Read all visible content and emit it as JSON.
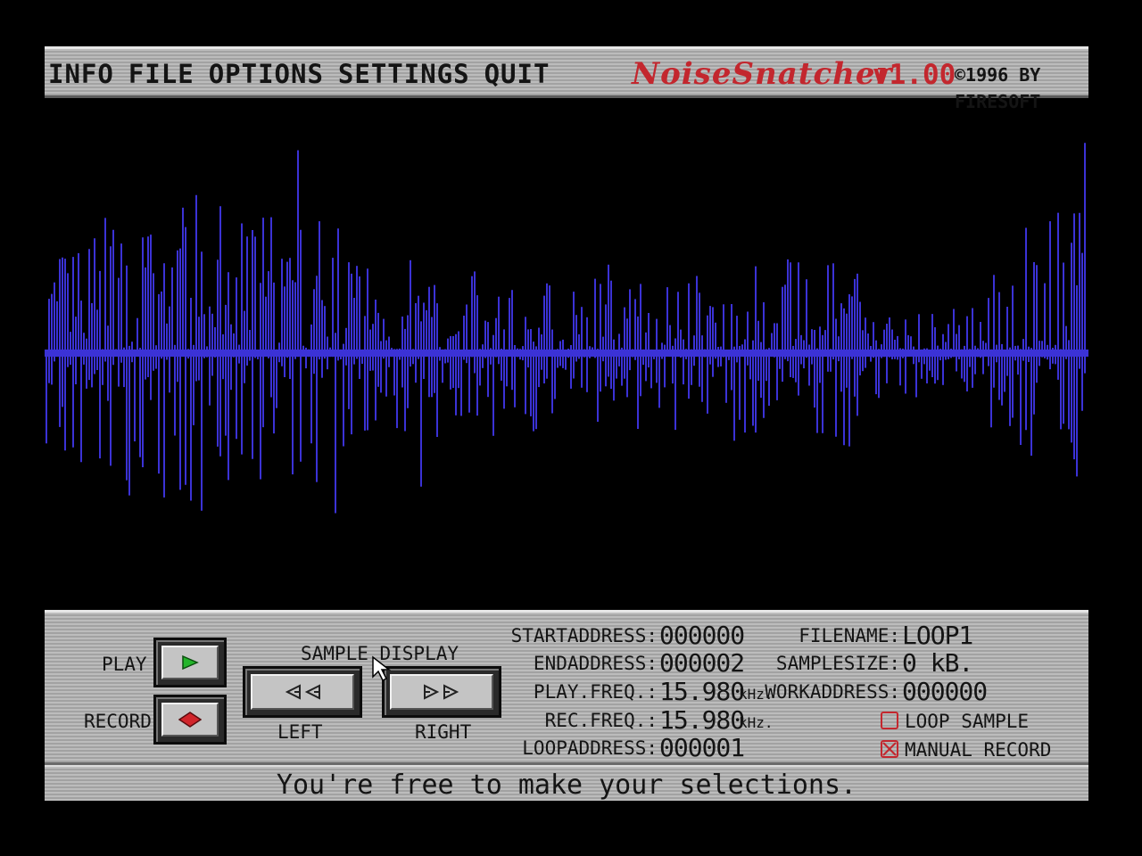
{
  "menu": {
    "items": [
      "INFO",
      "FILE",
      "OPTIONS",
      "SETTINGS",
      "QUIT"
    ],
    "app_title": "NoiseSnatcher",
    "app_version": "v1.00",
    "copyright": "©1996 BY FIRESOFT"
  },
  "colors": {
    "waveform": "#3b32d6",
    "title_red": "#c3272e",
    "play_green": "#23b52a",
    "record_red": "#d1252b"
  },
  "transport": {
    "play_label": "PLAY",
    "record_label": "RECORD",
    "play_icon": "play-triangle-icon",
    "record_icon": "record-diamond-icon"
  },
  "sample_display": {
    "title": "SAMPLE DISPLAY",
    "left_label": "LEFT",
    "right_label": "RIGHT",
    "left_icon": "double-left-arrow-icon",
    "right_icon": "double-right-arrow-icon"
  },
  "info": {
    "startaddress_label": "STARTADDRESS:",
    "startaddress": "000000",
    "endaddress_label": "ENDADDRESS:",
    "endaddress": "000002",
    "playfreq_label": "PLAY.FREQ.:",
    "playfreq": "15.980",
    "recfreq_label": "REC.FREQ.:",
    "recfreq": "15.980",
    "freq_unit": "kHz.",
    "loopaddress_label": "LOOPADDRESS:",
    "loopaddress": "000001",
    "filename_label": "FILENAME:",
    "filename": "LOOP1",
    "samplesize_label": "SAMPLESIZE:",
    "samplesize": "0 kB.",
    "workaddress_label": "WORKADDRESS:",
    "workaddress": "000000"
  },
  "options": {
    "loop_sample_label": "LOOP SAMPLE",
    "loop_sample_checked": false,
    "manual_record_label": "MANUAL RECORD",
    "manual_record_checked": true
  },
  "status": {
    "text": "You're free to make your selections."
  }
}
